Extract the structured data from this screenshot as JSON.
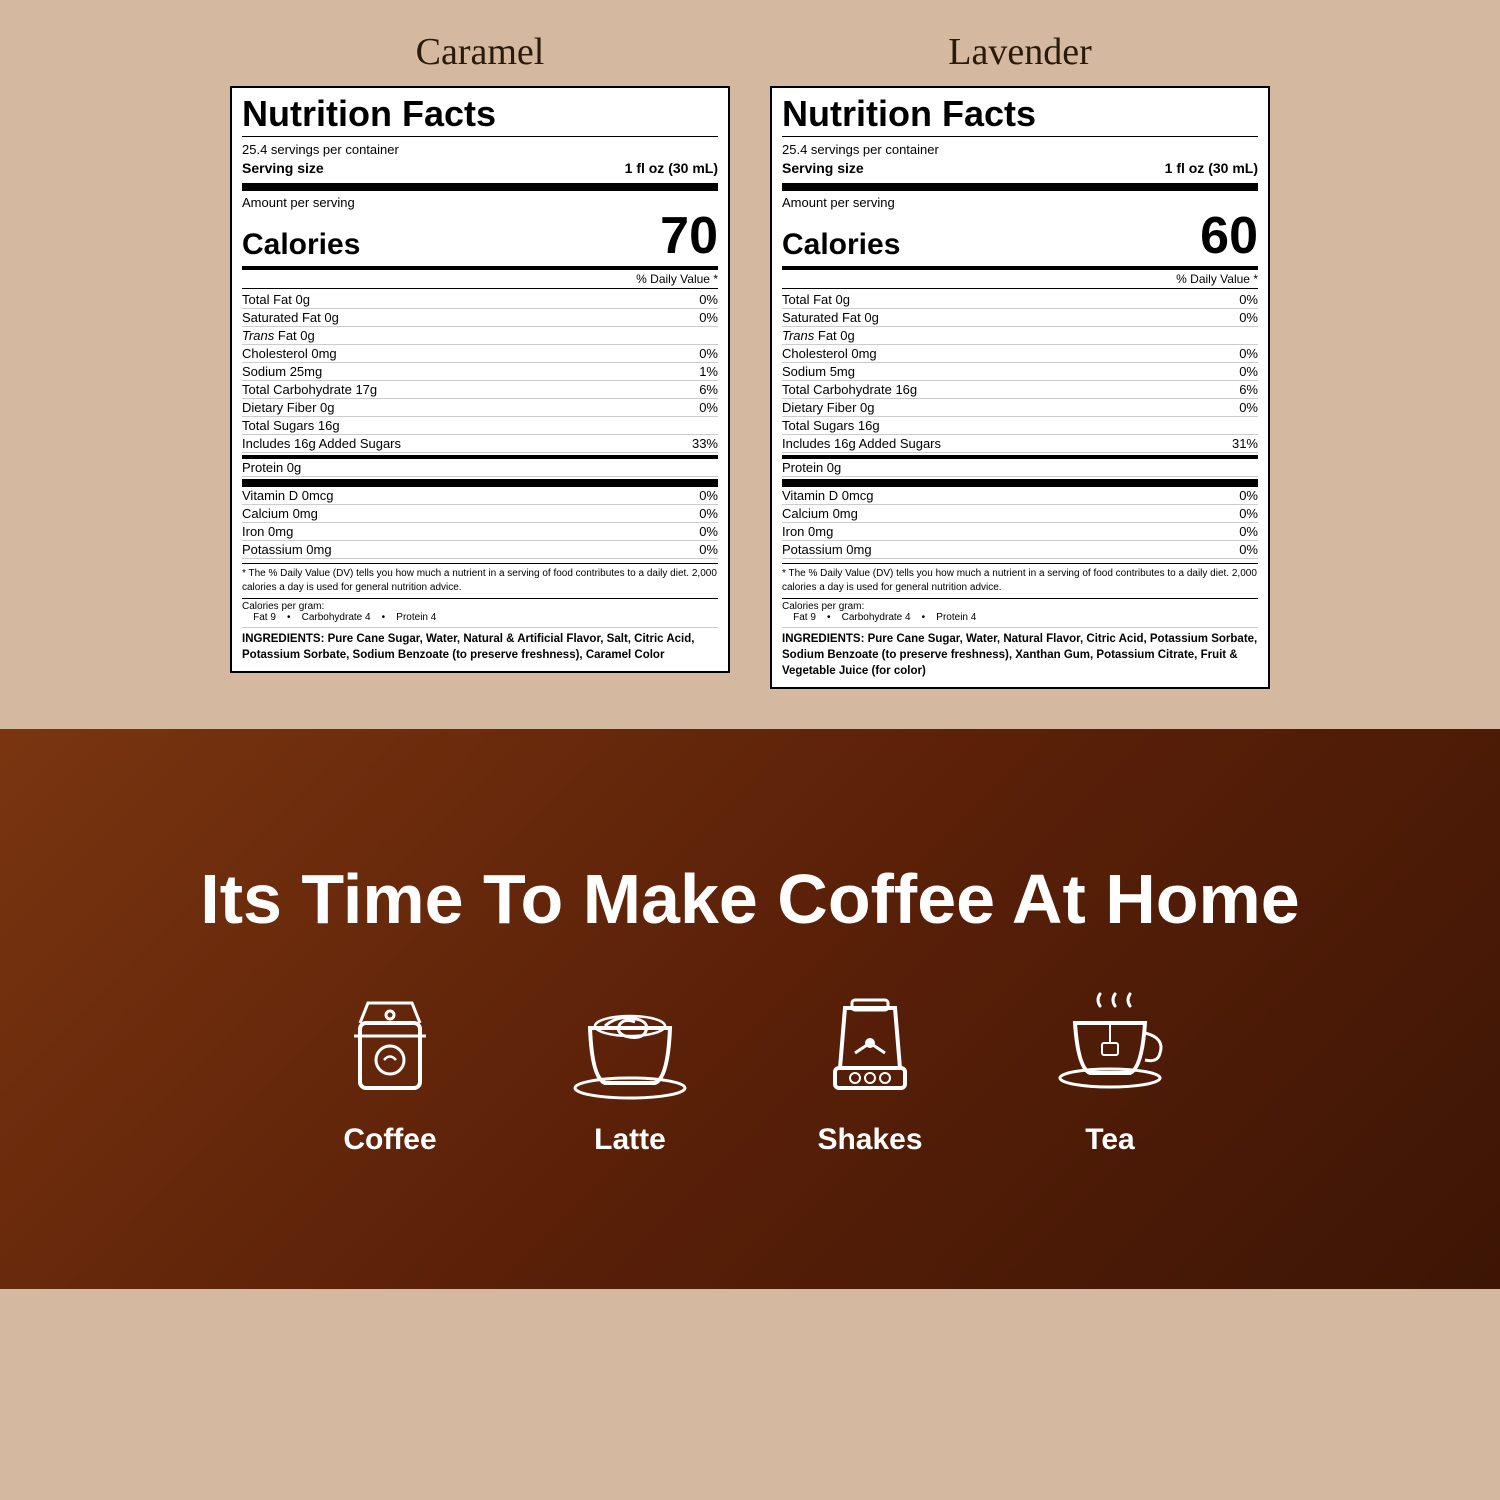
{
  "caramel": {
    "title": "Caramel",
    "nutrition_title": "Nutrition Facts",
    "servings_per_container": "25.4 servings per container",
    "serving_size_label": "Serving size",
    "serving_size_value": "1 fl oz (30 mL)",
    "amount_per_serving": "Amount per serving",
    "calories_label": "Calories",
    "calories_value": "70",
    "daily_value_header": "% Daily Value *",
    "nutrients": [
      {
        "name": "Total Fat 0g",
        "value": "0%",
        "indent": 0,
        "bold": true
      },
      {
        "name": "Saturated Fat 0g",
        "value": "0%",
        "indent": 1,
        "bold": false
      },
      {
        "name": "Trans Fat 0g",
        "value": "",
        "indent": 2,
        "bold": false,
        "italic": true
      },
      {
        "name": "Cholesterol 0mg",
        "value": "0%",
        "indent": 0,
        "bold": true
      },
      {
        "name": "Sodium 25mg",
        "value": "1%",
        "indent": 0,
        "bold": true
      },
      {
        "name": "Total Carbohydrate 17g",
        "value": "6%",
        "indent": 0,
        "bold": true
      },
      {
        "name": "Dietary Fiber 0g",
        "value": "0%",
        "indent": 1,
        "bold": false
      },
      {
        "name": "Total Sugars 16g",
        "value": "",
        "indent": 1,
        "bold": false
      },
      {
        "name": "Includes 16g Added Sugars",
        "value": "33%",
        "indent": 2,
        "bold": false
      },
      {
        "name": "Protein 0g",
        "value": "",
        "indent": 0,
        "bold": true
      }
    ],
    "vitamins": [
      {
        "name": "Vitamin D 0mcg",
        "value": "0%"
      },
      {
        "name": "Calcium 0mg",
        "value": "0%"
      },
      {
        "name": "Iron 0mg",
        "value": "0%"
      },
      {
        "name": "Potassium 0mg",
        "value": "0%"
      }
    ],
    "footnote": "* The % Daily Value (DV) tells you how much a nutrient in a serving of food contributes to a daily diet. 2,000 calories a day is used for general nutrition advice.",
    "calories_per_gram": "Calories per gram:\n    Fat 9    •    Carbohydrate 4    •    Protein 4",
    "ingredients_label": "INGREDIENTS:",
    "ingredients_text": " Pure Cane Sugar, Water, Natural & Artificial Flavor, Salt, Citric Acid, Potassium Sorbate, Sodium Benzoate (to preserve freshness), Caramel Color"
  },
  "lavender": {
    "title": "Lavender",
    "nutrition_title": "Nutrition Facts",
    "servings_per_container": "25.4 servings per container",
    "serving_size_label": "Serving size",
    "serving_size_value": "1 fl oz (30 mL)",
    "amount_per_serving": "Amount per serving",
    "calories_label": "Calories",
    "calories_value": "60",
    "daily_value_header": "% Daily Value *",
    "nutrients": [
      {
        "name": "Total Fat 0g",
        "value": "0%",
        "indent": 0,
        "bold": true
      },
      {
        "name": "Saturated Fat 0g",
        "value": "0%",
        "indent": 1,
        "bold": false
      },
      {
        "name": "Trans Fat 0g",
        "value": "",
        "indent": 2,
        "bold": false,
        "italic": true
      },
      {
        "name": "Cholesterol 0mg",
        "value": "0%",
        "indent": 0,
        "bold": true
      },
      {
        "name": "Sodium 5mg",
        "value": "0%",
        "indent": 0,
        "bold": true
      },
      {
        "name": "Total Carbohydrate 16g",
        "value": "6%",
        "indent": 0,
        "bold": true
      },
      {
        "name": "Dietary Fiber 0g",
        "value": "0%",
        "indent": 1,
        "bold": false
      },
      {
        "name": "Total Sugars 16g",
        "value": "",
        "indent": 1,
        "bold": false
      },
      {
        "name": "Includes 16g Added Sugars",
        "value": "31%",
        "indent": 2,
        "bold": false
      },
      {
        "name": "Protein 0g",
        "value": "",
        "indent": 0,
        "bold": true
      }
    ],
    "vitamins": [
      {
        "name": "Vitamin D 0mcg",
        "value": "0%"
      },
      {
        "name": "Calcium 0mg",
        "value": "0%"
      },
      {
        "name": "Iron 0mg",
        "value": "0%"
      },
      {
        "name": "Potassium 0mg",
        "value": "0%"
      }
    ],
    "footnote": "* The % Daily Value (DV) tells you how much a nutrient in a serving of food contributes to a daily diet. 2,000 calories a day is used for general nutrition advice.",
    "calories_per_gram": "Calories per gram:\n    Fat 9    •    Carbohydrate 4    •    Protein 4",
    "ingredients_label": "INGREDIENTS:",
    "ingredients_text": " Pure Cane Sugar, Water, Natural Flavor, Citric Acid, Potassium Sorbate, Sodium Benzoate (to preserve freshness), Xanthan Gum, Potassium Citrate, Fruit & Vegetable Juice (for color)"
  },
  "bottom": {
    "tagline": "Its Time To Make Coffee At Home",
    "icons": [
      {
        "label": "Coffee",
        "name": "coffee-icon"
      },
      {
        "label": "Latte",
        "name": "latte-icon"
      },
      {
        "label": "Shakes",
        "name": "shakes-icon"
      },
      {
        "label": "Tea",
        "name": "tea-icon"
      }
    ]
  }
}
